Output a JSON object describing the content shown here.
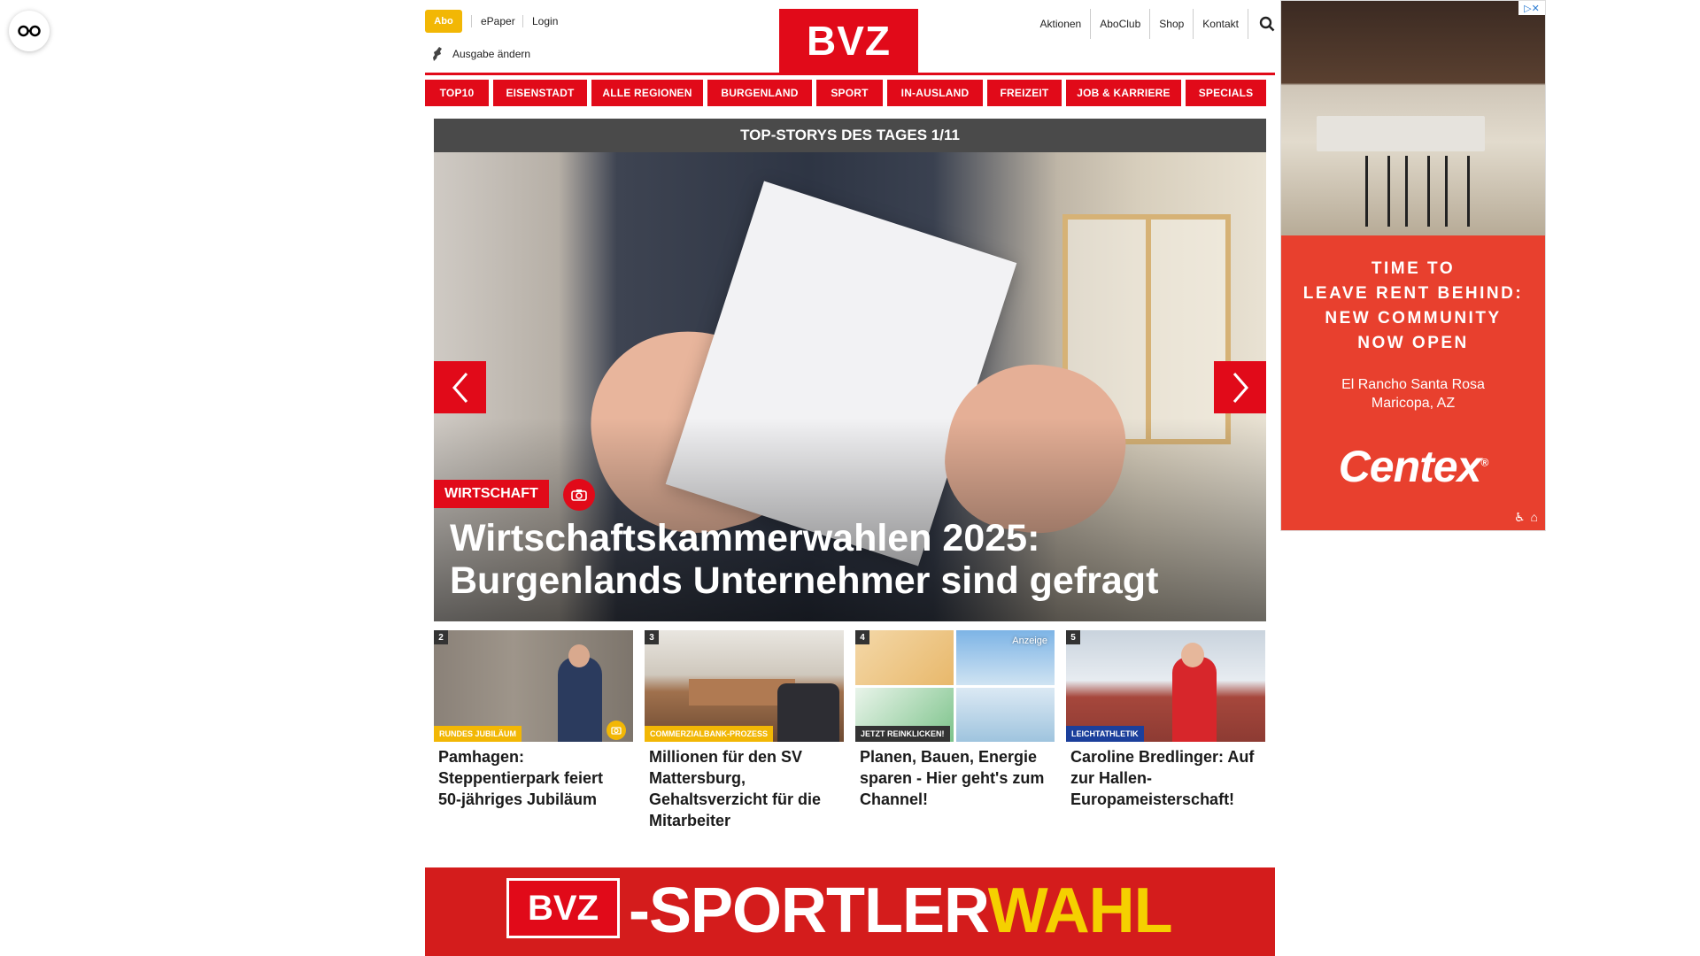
{
  "header": {
    "abo_label": "Abo",
    "epaper_label": "ePaper",
    "login_label": "Login",
    "edition_label": "Ausgabe ändern",
    "logo_text": "BVZ",
    "right_links": [
      "Aktionen",
      "AboClub",
      "Shop",
      "Kontakt"
    ]
  },
  "nav": {
    "items": [
      "TOP10",
      "EISENSTADT",
      "ALLE REGIONEN",
      "BURGENLAND",
      "SPORT",
      "IN-AUSLAND",
      "FREIZEIT",
      "JOB & KARRIERE",
      "SPECIALS"
    ]
  },
  "topstories": {
    "bar_label": "TOP-STORYS DES TAGES 1/11",
    "hero": {
      "category": "WIRTSCHAFT",
      "title": "Wirtschaftskammerwahlen 2025: Burgenlands Unternehmer sind gefragt"
    },
    "cards": [
      {
        "number": "2",
        "badge": "RUNDES JUBILÄUM",
        "title": "Pamhagen: Steppentierpark feiert 50-jähriges Jubiläum"
      },
      {
        "number": "3",
        "badge": "COMMERZIALBANK-PROZESS",
        "title": "Millionen für den SV Mattersburg, Gehaltsverzicht für die Mitarbeiter"
      },
      {
        "number": "4",
        "badge": "JETZT REINKLICKEN!",
        "ad_label": "Anzeige",
        "title": "Planen, Bauen, Energie sparen - Hier geht's zum Channel!"
      },
      {
        "number": "5",
        "badge": "LEICHTATHLETIK",
        "title": "Caroline Bredlinger: Auf zur Hallen-Europameisterschaft!"
      }
    ]
  },
  "ad": {
    "headline_lines": [
      "TIME TO",
      "LEAVE RENT BEHIND:",
      "NEW COMMUNITY",
      "NOW OPEN"
    ],
    "location_lines": [
      "El Rancho Santa Rosa",
      "Maricopa, AZ"
    ],
    "brand": "Centex",
    "brand_mark": "®"
  },
  "banner": {
    "logo_text": "BVZ",
    "text_white": "-SPORTLER",
    "text_yellow": "WAHL"
  },
  "colors": {
    "brand_red": "#e10a19",
    "abo_yellow": "#f2b705",
    "badge_yellow": "#f2b705",
    "badge_dark": "#333333",
    "badge_blue": "#1b3f9b"
  }
}
